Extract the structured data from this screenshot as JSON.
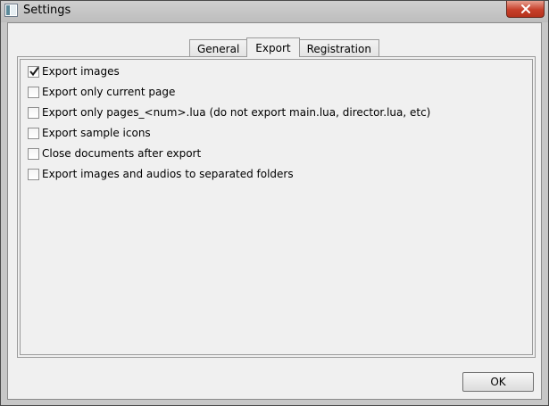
{
  "window": {
    "title": "Settings"
  },
  "tabs": [
    {
      "label": "General",
      "active": false
    },
    {
      "label": "Export",
      "active": true
    },
    {
      "label": "Registration",
      "active": false
    }
  ],
  "export_options": [
    {
      "label": "Export images",
      "checked": true
    },
    {
      "label": "Export only current page",
      "checked": false
    },
    {
      "label": "Export only pages_<num>.lua (do not export main.lua, director.lua, etc)",
      "checked": false
    },
    {
      "label": "Export sample icons",
      "checked": false
    },
    {
      "label": "Close documents after export",
      "checked": false
    },
    {
      "label": "Export images and audios to separated folders",
      "checked": false
    }
  ],
  "buttons": {
    "ok_label": "OK"
  },
  "colors": {
    "close_button": "#c7402b",
    "dialog_background": "#f0f0f0",
    "window_frame": "#c7c7c7"
  }
}
